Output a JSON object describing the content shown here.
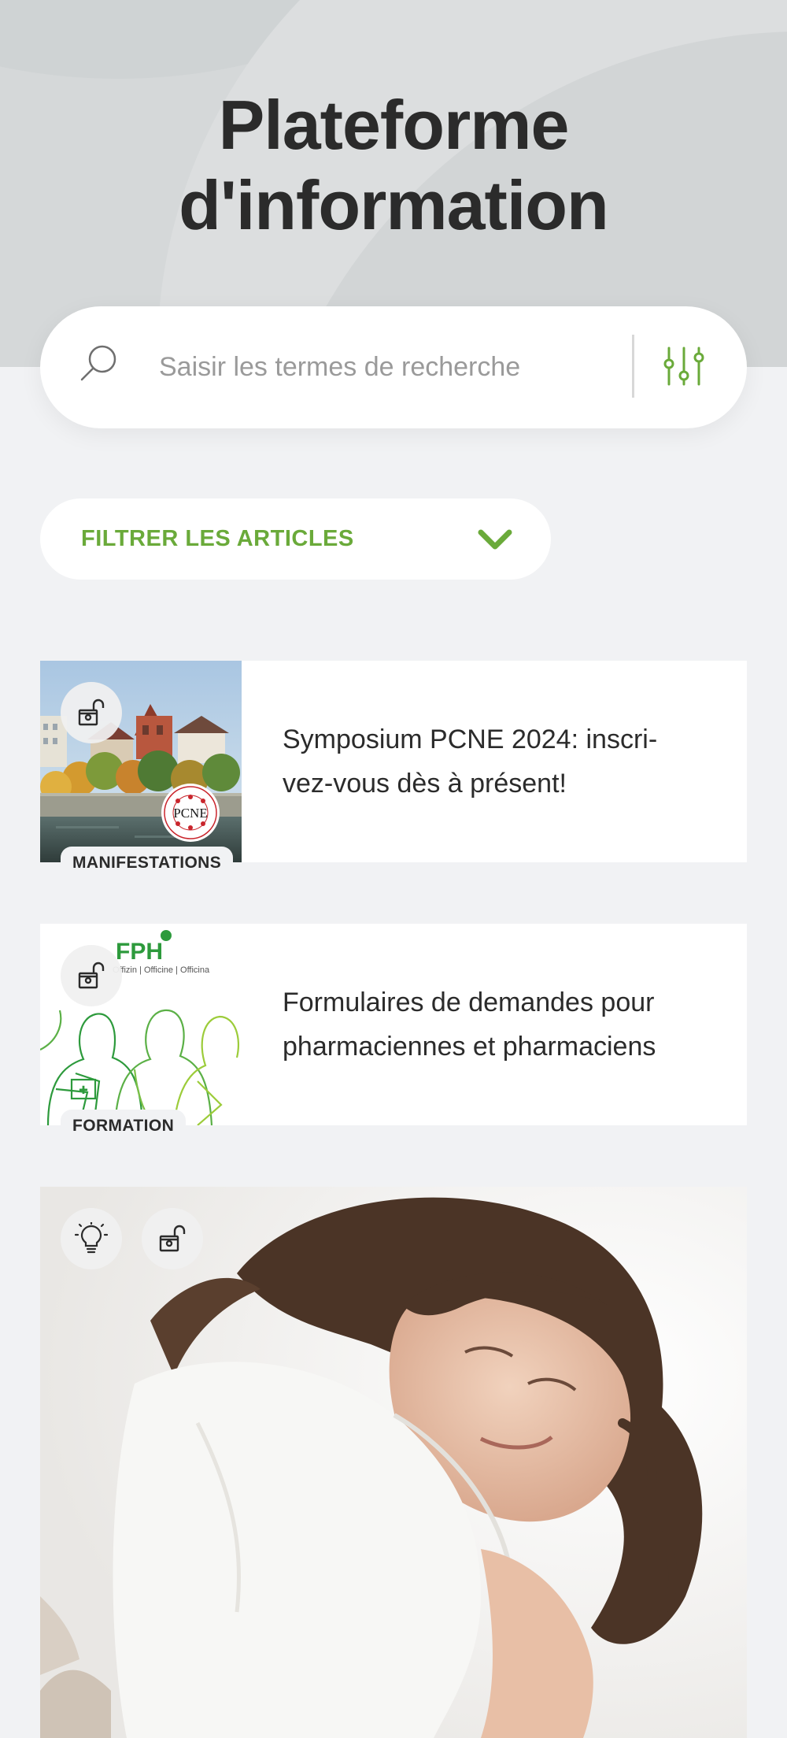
{
  "header": {
    "title_line1": "Plateforme",
    "title_line2": "d'information"
  },
  "search": {
    "placeholder": "Saisir les termes de recherche",
    "value": "",
    "search_icon": "search-icon",
    "filter_icon": "sliders-icon"
  },
  "filter": {
    "label": "FILTRER LES ARTICLES",
    "icon": "chevron-down-icon"
  },
  "articles": [
    {
      "title": "Symposium PCNE 2024: inscri-vez-vous dès à présent!",
      "category": "MANIFESTATIONS",
      "icons": [
        "unlock-icon"
      ],
      "image_logo_text": "PCNE",
      "image_logo_ring_text": "Pharmaceutical Care Network Europe"
    },
    {
      "title": "Formulaires de demandes pour pharmaciennes et pharmaciens",
      "category": "FORMATION",
      "icons": [
        "unlock-icon"
      ],
      "image_brand": "FPH",
      "image_subtitle": "Offizin | Officine | Officina"
    },
    {
      "title": "",
      "category": "",
      "icons": [
        "lightbulb-icon",
        "unlock-icon"
      ]
    }
  ],
  "colors": {
    "accent": "#6aaa3a",
    "background": "#f1f2f4",
    "hero": "#d5d8d9"
  }
}
